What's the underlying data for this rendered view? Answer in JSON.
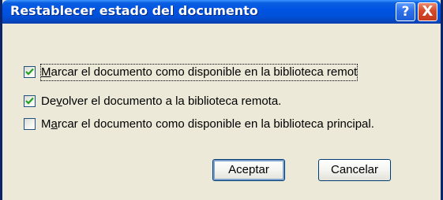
{
  "dialog": {
    "title": "Restablecer estado del documento",
    "help_glyph": "?",
    "close_glyph": "X"
  },
  "options": [
    {
      "label_before": "",
      "mnemonic": "M",
      "label_after": "arcar el documento como disponible en la biblioteca remot",
      "checked": true
    },
    {
      "label_before": "De",
      "mnemonic": "v",
      "label_after": "olver el documento a la biblioteca remota.",
      "checked": true
    },
    {
      "label_before": "M",
      "mnemonic": "a",
      "label_after": "rcar el documento como disponible en la biblioteca principal.",
      "checked": false
    }
  ],
  "buttons": {
    "ok": "Aceptar",
    "cancel": "Cancelar"
  },
  "colors": {
    "title_bar": "#0054e3",
    "window_bg": "#ece9d8",
    "checkmark": "#21a121",
    "close_button": "#d6492b"
  }
}
